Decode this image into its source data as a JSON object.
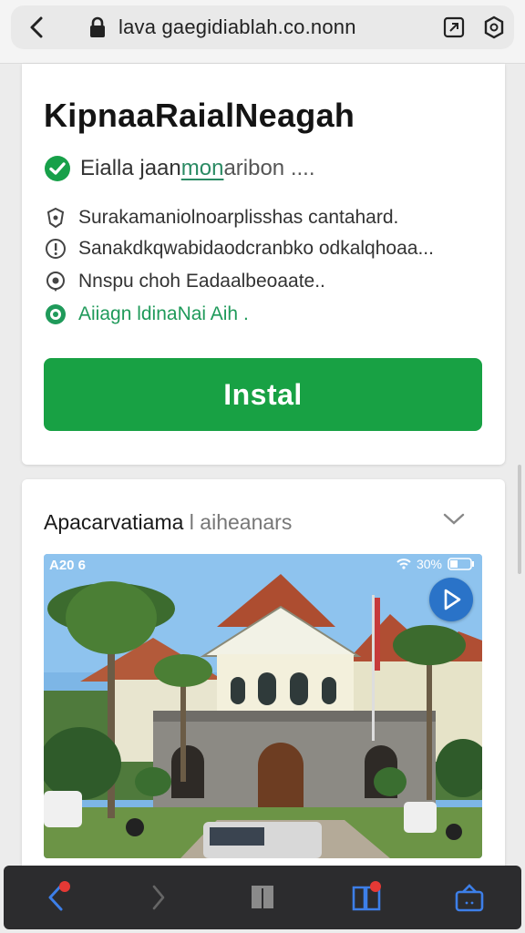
{
  "browser": {
    "url": "lava gaegidiablah.co.nonn",
    "icons": [
      "back-chevron-icon",
      "lock-icon",
      "share-box-icon",
      "settings-icon"
    ]
  },
  "app": {
    "title": "KipnaaRaialNeagah",
    "verified_prefix": "Eialla jaan ",
    "verified_link": "mon",
    "verified_rest": "aribon ....",
    "info": [
      {
        "icon": "shield-icon",
        "text": "Surakamaniolnoarplisshas cantahard."
      },
      {
        "icon": "alert-icon",
        "text": "Sanakdkqwabidaodcranbko odkalqhoaa..."
      },
      {
        "icon": "location-icon",
        "text": "Nnspu choh Eadaalbeoaate.."
      },
      {
        "icon": "chat-icon",
        "text": "Aiiagn ldinaNai Aih ."
      }
    ],
    "install_label": "Instal",
    "accent": "#18a144"
  },
  "section": {
    "title_main": "Apacarvatiama",
    "title_dim": " l aiheanars",
    "screenshot": {
      "status_left": "A20 6",
      "status_right": "30%"
    }
  },
  "bottom_nav": {
    "items": [
      "back-icon",
      "forward-icon",
      "tabs-icon",
      "bookmarks-icon",
      "share-icon"
    ]
  }
}
